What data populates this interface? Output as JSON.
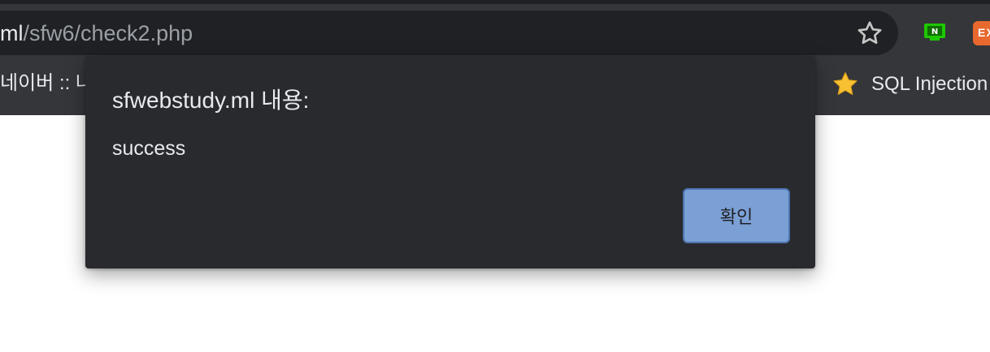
{
  "browser": {
    "url_host_fragment": "ml",
    "url_path": "/sfw6/check2.php",
    "star_icon": "star-outline-icon",
    "extensions": [
      {
        "icon": "naver-extension-icon",
        "label": "N"
      },
      {
        "icon": "ex-extension-icon",
        "label": "EX"
      }
    ]
  },
  "bookmarks": {
    "left_label": "네이버 :: 나",
    "right_label": "SQL Injection",
    "right_icon": "star-filled-icon"
  },
  "dialog": {
    "title": "sfwebstudy.ml 내용:",
    "message": "success",
    "ok_label": "확인"
  },
  "colors": {
    "toolbar": "#35363a",
    "omnibox": "#202124",
    "dialog_bg": "#292a2d",
    "button_bg": "#7ba0d6",
    "button_border": "#4d74b0",
    "text": "#e8eaed"
  }
}
